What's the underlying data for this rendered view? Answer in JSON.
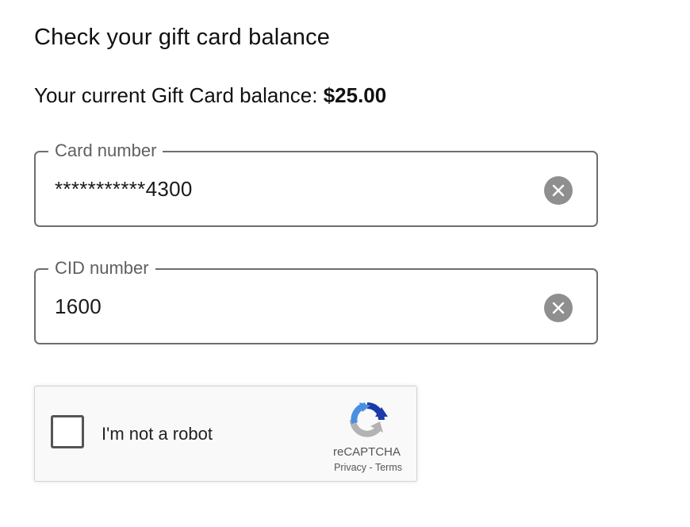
{
  "heading": "Check your gift card balance",
  "balance": {
    "label": "Your current Gift Card balance:",
    "amount": "$25.00"
  },
  "card_number_field": {
    "label": "Card number",
    "value": "***********4300",
    "clear_icon": "close-circle-icon"
  },
  "cid_field": {
    "label": "CID number",
    "value": "1600",
    "clear_icon": "close-circle-icon"
  },
  "recaptcha": {
    "checkbox_label": "I'm not a robot",
    "checked": false,
    "brand": "reCAPTCHA",
    "privacy": "Privacy",
    "separator": "-",
    "terms": "Terms",
    "logo_icon": "recaptcha-logo-icon"
  },
  "colors": {
    "clear_button": "#8f8f8f",
    "field_border": "#6e6e6e",
    "recaptcha_blue": "#1c3aa9",
    "recaptcha_lightblue": "#4a90e2",
    "recaptcha_gray": "#b3b3b3"
  }
}
